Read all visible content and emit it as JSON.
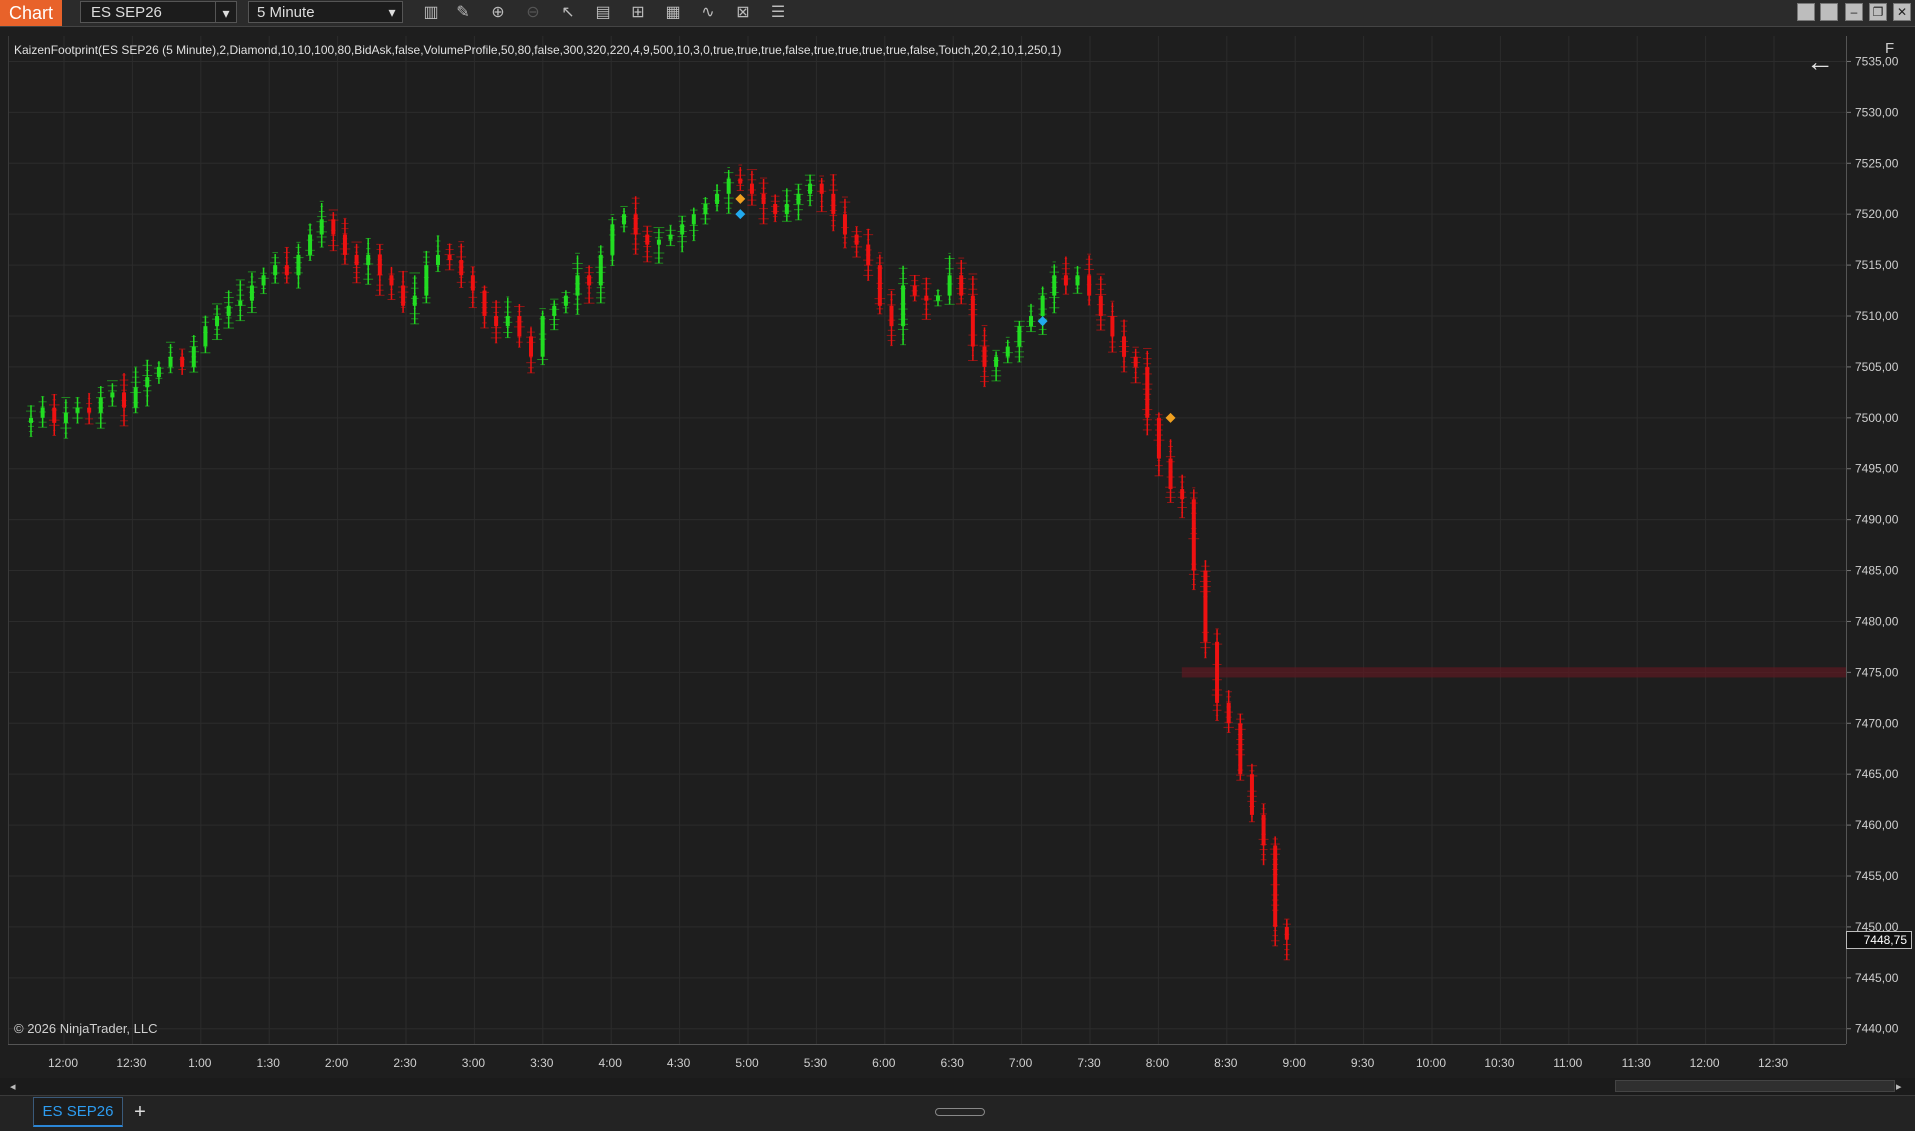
{
  "window": {
    "tab_title": "Chart",
    "instrument": "ES SEP26",
    "interval": "5 Minute"
  },
  "toolbar": {
    "icons": [
      "bar-type-icon",
      "draw-tool-icon",
      "zoom-in-icon",
      "zoom-out-icon",
      "pointer-icon",
      "data-box-icon",
      "properties-icon",
      "indicators-icon",
      "strategies-icon",
      "templates-icon",
      "menu-icon"
    ]
  },
  "chart": {
    "indicator_label": "KaizenFootprint(ES SEP26 (5 Minute),2,Diamond,10,10,100,80,BidAsk,false,VolumeProfile,50,80,false,300,320,220,4,9,500,10,3,0,true,true,true,false,true,true,true,true,false,Touch,20,2,10,1,250,1)",
    "copyright": "© 2026 NinjaTrader, LLC",
    "f_button": "F",
    "last_price_label": "7448,75",
    "colors": {
      "up": "#22dd22",
      "down": "#ee1111",
      "background": "#1e1e1e",
      "grid": "#2c2c2c",
      "zone": "#5a1a22",
      "diamond_orange": "#f0a020",
      "diamond_blue": "#22aaee"
    }
  },
  "chart_data": {
    "type": "candlestick",
    "instrument": "ES SEP26",
    "ylim": [
      7438.5,
      7537.5
    ],
    "y_ticks": [
      "7535,00",
      "7530,00",
      "7525,00",
      "7520,00",
      "7515,00",
      "7510,00",
      "7505,00",
      "7500,00",
      "7495,00",
      "7490,00",
      "7485,00",
      "7480,00",
      "7475,00",
      "7470,00",
      "7465,00",
      "7460,00",
      "7455,00",
      "7450,00",
      "7445,00",
      "7440,00"
    ],
    "x_ticks": [
      "12:00",
      "12:30",
      "1:00",
      "1:30",
      "2:00",
      "2:30",
      "3:00",
      "3:30",
      "4:00",
      "4:30",
      "5:00",
      "5:30",
      "6:00",
      "6:30",
      "7:00",
      "7:30",
      "8:00",
      "8:30",
      "9:00",
      "9:30",
      "10:00",
      "10:30",
      "11:00",
      "11:30",
      "12:00",
      "12:30"
    ],
    "path": [
      7500,
      7501,
      7499.5,
      7500.5,
      7501,
      7500.5,
      7502,
      7502.5,
      7501,
      7503,
      7504,
      7505,
      7506,
      7505,
      7507,
      7509,
      7510,
      7511,
      7511.5,
      7513,
      7514,
      7515,
      7514,
      7516,
      7518,
      7519.5,
      7518,
      7516,
      7515,
      7516,
      7514,
      7513,
      7511,
      7512,
      7515,
      7516,
      7515.5,
      7514,
      7512.5,
      7510,
      7509,
      7510,
      7508,
      7506,
      7510,
      7511,
      7512,
      7514,
      7513,
      7516,
      7519,
      7520,
      7518,
      7517,
      7517.5,
      7518,
      7519,
      7520,
      7521,
      7522,
      7523.5,
      7523,
      7522,
      7521,
      7520,
      7521,
      7522,
      7523,
      7522,
      7520,
      7518,
      7517,
      7515,
      7511,
      7509,
      7513,
      7512,
      7511.5,
      7512,
      7514,
      7512,
      7507,
      7505,
      7506,
      7507,
      7509,
      7510,
      7512,
      7514,
      7513,
      7514,
      7512,
      7510,
      7508,
      7506,
      7505,
      7500,
      7496,
      7493,
      7492,
      7485,
      7478,
      7472,
      7470,
      7465,
      7461,
      7458,
      7450,
      7448.75
    ],
    "zone": {
      "from": 7474.5,
      "to": 7475.5,
      "start_index": 102
    },
    "diamonds": [
      {
        "i": 61,
        "price": 7521.5,
        "color": "orange"
      },
      {
        "i": 61,
        "price": 7520,
        "color": "blue"
      },
      {
        "i": 87,
        "price": 7509.5,
        "color": "blue"
      },
      {
        "i": 98,
        "price": 7500,
        "color": "orange"
      }
    ],
    "last_price": 7448.75
  },
  "scroll": {
    "left_arrow": "◂",
    "right_arrow": "▸"
  },
  "bottom": {
    "tab_label": "ES SEP26",
    "add_label": "+"
  }
}
